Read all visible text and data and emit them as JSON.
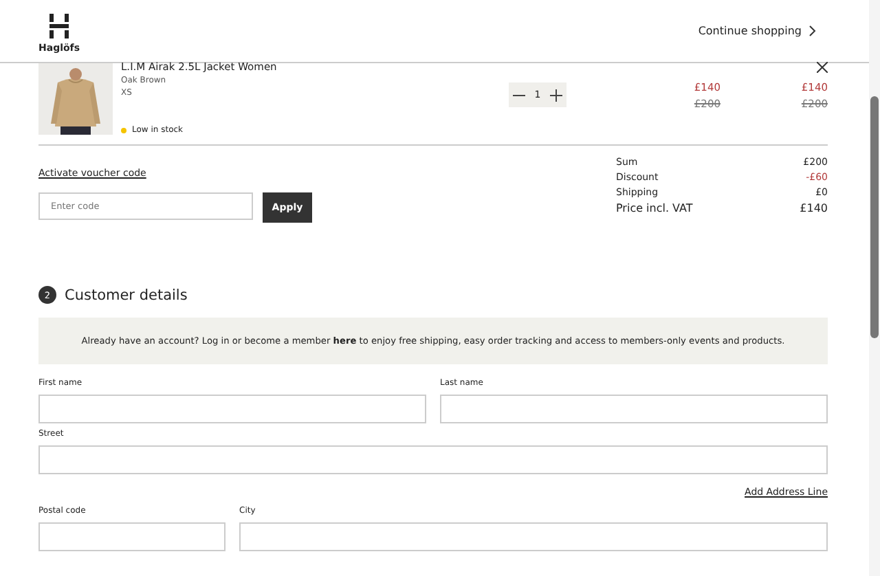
{
  "header": {
    "brand": "Haglöfs",
    "continue": "Continue shopping"
  },
  "cart_item": {
    "kind": "picture",
    "name": "L.I.M Airak 2.5L Jacket Women",
    "variant": "Oak Brown",
    "size": "XS",
    "stock": "Low in stock",
    "quantity": "1",
    "unit_price": "£140",
    "unit_price_old": "£200",
    "total_price": "£140",
    "total_price_old": "£200"
  },
  "voucher": {
    "link": "Activate voucher code",
    "placeholder": "Enter code",
    "button": "Apply"
  },
  "summary": [
    {
      "label": "Sum",
      "value": "£200",
      "kind": "normal"
    },
    {
      "label": "Discount",
      "value": "-£60",
      "kind": "discount"
    },
    {
      "label": "Shipping",
      "value": "£0",
      "kind": "normal"
    },
    {
      "label": "Price incl. VAT",
      "value": "£140",
      "kind": "total"
    }
  ],
  "section": {
    "number": "2",
    "title": "Customer details"
  },
  "member_notice": "Already have an account? Log in or become a member **here** to enjoy free shipping, easy order tracking and access to members-only events and products.",
  "fields": [
    {
      "label": "First name",
      "kind": "half"
    },
    {
      "label": "Last name",
      "kind": "half"
    },
    {
      "label": "Street",
      "kind": "full"
    }
  ],
  "add_address_line": "Add Address Line",
  "fields_2": [
    {
      "label": "Postal code"
    },
    {
      "label": "City"
    }
  ]
}
